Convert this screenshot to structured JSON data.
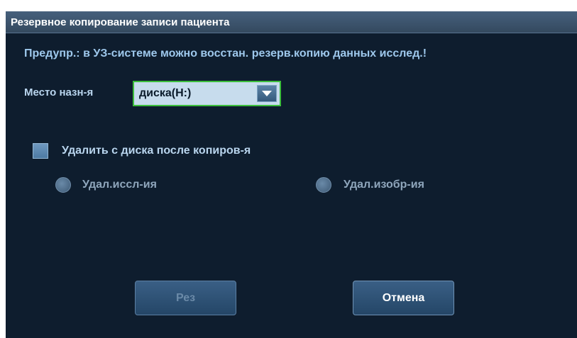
{
  "dialog": {
    "title": "Резервное копирование записи пациента",
    "warning": "Предупр.: в УЗ-системе можно восстан. резерв.копию данных исслед.!",
    "destination": {
      "label": "Место назн-я",
      "selected_value": "диска(H:)"
    },
    "delete_after_copy": {
      "label": "Удалить с диска после копиров-я",
      "checked": false
    },
    "delete_options": [
      {
        "label": "Удал.иссл-ия",
        "enabled": false
      },
      {
        "label": "Удал.изобр-ия",
        "enabled": false
      }
    ],
    "buttons": {
      "save_label": "Рез",
      "cancel_label": "Отмена"
    }
  },
  "colors": {
    "background": "#0e1d2e",
    "titlebar": "#3d556e",
    "focus_border": "#3cbe3c",
    "warning_text": "#9ec8ec"
  },
  "icons": {
    "dropdown": "chevron-down-icon"
  }
}
